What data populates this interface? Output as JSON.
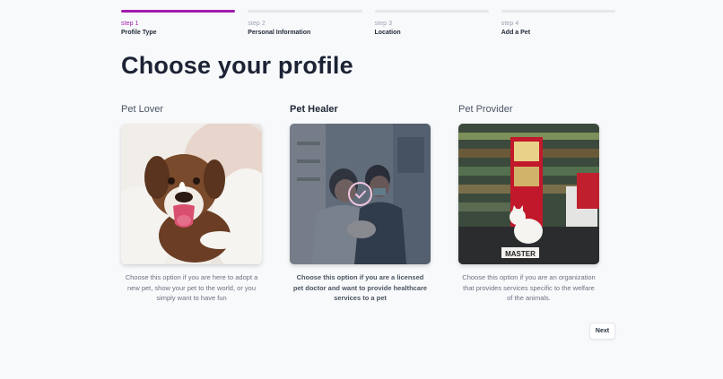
{
  "stepper": {
    "steps": [
      {
        "num": "step 1",
        "name": "Profile Type",
        "active": true
      },
      {
        "num": "step 2",
        "name": "Personal Information",
        "active": false
      },
      {
        "num": "step 3",
        "name": "Location",
        "active": false
      },
      {
        "num": "step 4",
        "name": "Add a Pet",
        "active": false
      }
    ]
  },
  "title": "Choose your profile",
  "options": [
    {
      "name": "Pet Lover",
      "description": "Choose this option if you are here to adopt a new pet, show your pet to the world, or you simply want to have fun",
      "selected": false
    },
    {
      "name": "Pet Healer",
      "description": "Choose this option if you are a licensed pet doctor and want to provide healthcare services to a pet",
      "selected": true
    },
    {
      "name": "Pet Provider",
      "description": "Choose this option if you are an organization that provides services specific to the welfare of the animals.",
      "selected": false
    }
  ],
  "shop_sign": "MASTER",
  "next_label": "Next",
  "colors": {
    "accent": "#a21caf",
    "background": "#f8f9fb"
  }
}
